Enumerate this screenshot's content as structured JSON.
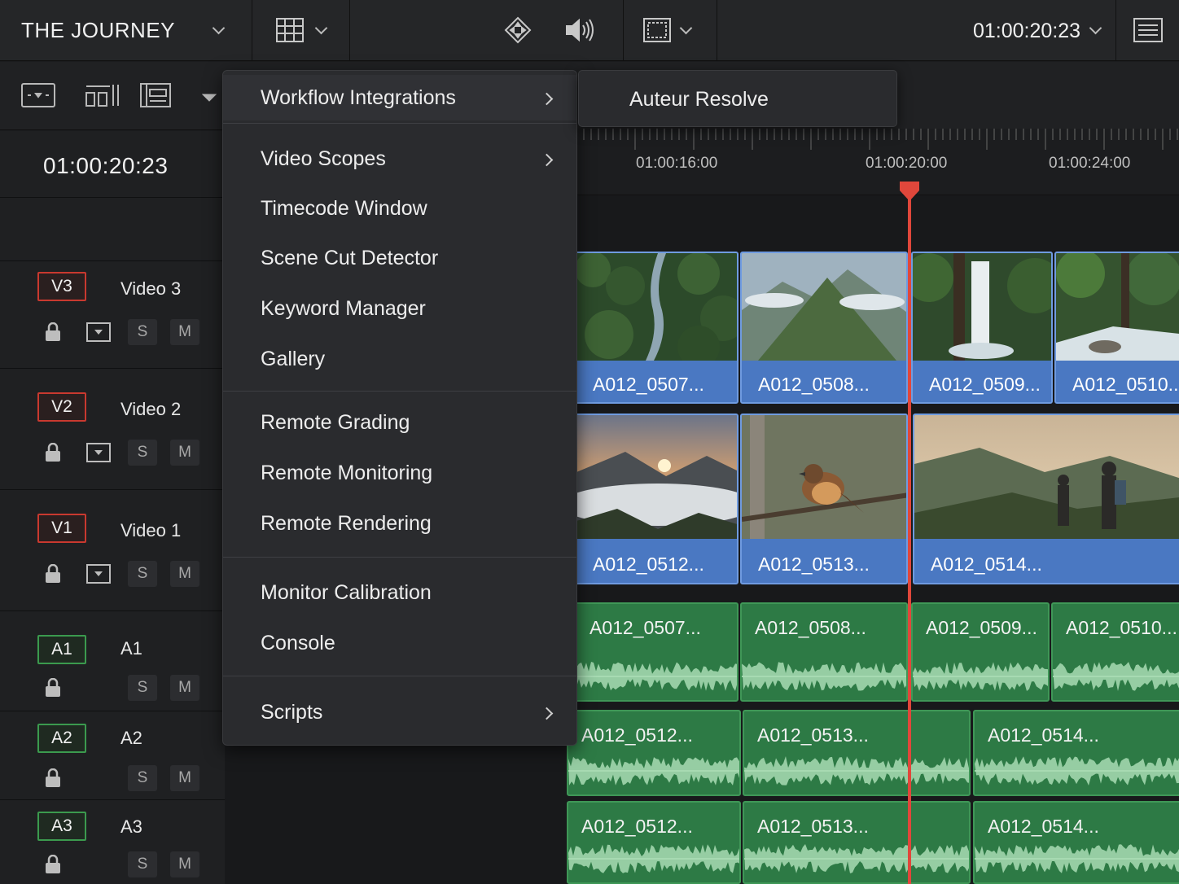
{
  "project": {
    "title": "THE JOURNEY",
    "timecode": "01:00:20:23"
  },
  "toolbar_icons": [
    "grid-view-icon",
    "transform-icon",
    "volume-icon",
    "viewer-frame-icon",
    "metadata-panel-icon"
  ],
  "secondbar_icons": [
    "viewer-mode-icon",
    "timeline-view-options-icon",
    "edit-mode-icon",
    "more-dropdown-icon"
  ],
  "timeline": {
    "current_timecode": "01:00:20:23",
    "ruler_labels": [
      "01:00:16:00",
      "01:00:20:00",
      "01:00:24:00"
    ],
    "playhead_color": "#e0473b"
  },
  "tracks": [
    {
      "id": "V3",
      "name": "Video 3",
      "type": "video",
      "solo": "S",
      "mute": "M"
    },
    {
      "id": "V2",
      "name": "Video 2",
      "type": "video",
      "solo": "S",
      "mute": "M"
    },
    {
      "id": "V1",
      "name": "Video 1",
      "type": "video",
      "solo": "S",
      "mute": "M"
    },
    {
      "id": "A1",
      "name": "A1",
      "type": "audio",
      "solo": "S",
      "mute": "M"
    },
    {
      "id": "A2",
      "name": "A2",
      "type": "audio",
      "solo": "S",
      "mute": "M"
    },
    {
      "id": "A3",
      "name": "A3",
      "type": "audio",
      "solo": "S",
      "mute": "M"
    }
  ],
  "clips": {
    "v2": [
      "A012_0507...",
      "A012_0508...",
      "A012_0509...",
      "A012_0510..."
    ],
    "v1": [
      "A012_0512...",
      "A012_0513...",
      "A012_0514..."
    ],
    "a1": [
      "A012_0507...",
      "A012_0508...",
      "A012_0509...",
      "A012_0510..."
    ],
    "a2": [
      "A012_0512...",
      "A012_0513...",
      "A012_0514..."
    ],
    "a3": [
      "A012_0512...",
      "A012_0513...",
      "A012_0514..."
    ]
  },
  "menu": {
    "items": [
      {
        "label": "Workflow Integrations",
        "submenu": true
      },
      {
        "label": "Video Scopes",
        "submenu": true
      },
      {
        "label": "Timecode Window",
        "submenu": false
      },
      {
        "label": "Scene Cut Detector",
        "submenu": false
      },
      {
        "label": "Keyword Manager",
        "submenu": false
      },
      {
        "label": "Gallery",
        "submenu": false
      },
      {
        "label": "Remote Grading",
        "submenu": false
      },
      {
        "label": "Remote Monitoring",
        "submenu": false
      },
      {
        "label": "Remote Rendering",
        "submenu": false
      },
      {
        "label": "Monitor Calibration",
        "submenu": false
      },
      {
        "label": "Console",
        "submenu": false
      },
      {
        "label": "Scripts",
        "submenu": true
      }
    ],
    "submenu_items": [
      {
        "label": "Auteur Resolve"
      }
    ]
  },
  "colors": {
    "video_track_badge": "#c9392f",
    "audio_track_badge": "#3b9a4e",
    "video_clip": "#4a78c2",
    "audio_clip": "#2d7a45"
  }
}
